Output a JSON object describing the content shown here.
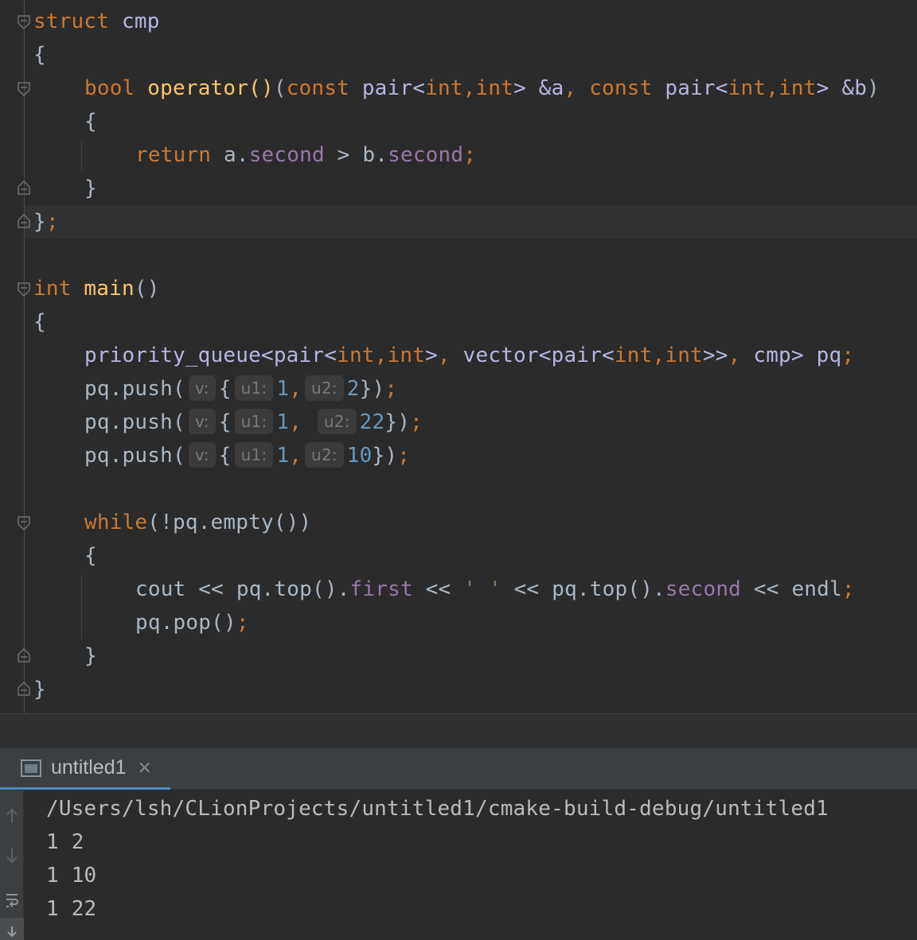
{
  "editor": {
    "lines": {
      "l1": {
        "kw": "struct",
        "name": "cmp"
      },
      "l2": {
        "brace": "{"
      },
      "l3": {
        "type": "bool",
        "fn": "operator",
        "parens": "()",
        "open": "(",
        "const1": "const",
        "pair1": "pair",
        "lt1": "<",
        "int1": "int",
        "comma1": ",",
        "int2": "int",
        "gt1": ">",
        "ref1": " &a",
        "sep": ",",
        "const2": "const",
        "pair2": "pair",
        "lt2": "<",
        "int3": "int",
        "comma2": ",",
        "int4": "int",
        "gt2": ">",
        "ref2": " &b",
        "close": ")"
      },
      "l4": {
        "brace": "{"
      },
      "l5": {
        "ret": "return",
        "a": "a.",
        "f1": "second",
        "op": " > ",
        "b": "b.",
        "f2": "second",
        "semi": ";"
      },
      "l6": {
        "brace": "}"
      },
      "l7": {
        "brace": "}",
        "semi": ";"
      },
      "l9": {
        "type": "int",
        "fn": "main",
        "parens": "()"
      },
      "l10": {
        "brace": "{"
      },
      "l11": {
        "pq": "priority_queue",
        "lt": "<",
        "pair": "pair",
        "lt2": "<",
        "int1": "int",
        "c1": ",",
        "int2": "int",
        "gt": ">",
        "c2": ",",
        "vec": "vector",
        "lt3": "<",
        "pair2": "pair",
        "lt4": "<",
        "int3": "int",
        "c3": ",",
        "int4": "int",
        "gt2": ">>",
        "c4": ",",
        "cmp": "cmp",
        "gt3": ">",
        "var": " pq",
        "semi": ";"
      },
      "push1": {
        "call": "pq.push(",
        "hint_v": "v:",
        "open": "{",
        "hint_u1": "u1:",
        "val1": "1",
        "comma": ",",
        "hint_u2": "u2:",
        "val2": "2",
        "close": "})",
        "semi": ";"
      },
      "push2": {
        "call": "pq.push(",
        "hint_v": "v:",
        "open": "{",
        "hint_u1": "u1:",
        "val1": "1",
        "comma": ",",
        "hint_u2": "u2:",
        "val2": "22",
        "close": "})",
        "semi": ";"
      },
      "push3": {
        "call": "pq.push(",
        "hint_v": "v:",
        "open": "{",
        "hint_u1": "u1:",
        "val1": "1",
        "comma": ",",
        "hint_u2": "u2:",
        "val2": "10",
        "close": "})",
        "semi": ";"
      },
      "l16": {
        "kw": "while",
        "rest": "(!pq.empty())"
      },
      "l17": {
        "brace": "{"
      },
      "l18": {
        "cout": "cout",
        "op1": " << ",
        "top1": "pq.top().",
        "first": "first",
        "op2": " << ",
        "space": "' '",
        "op3": " << ",
        "top2": "pq.top().",
        "second": "second",
        "op4": " << ",
        "endl": "endl",
        "semi": ";"
      },
      "l19": {
        "call": "pq.pop()",
        "semi": ";"
      },
      "l20": {
        "brace": "}"
      },
      "l21": {
        "brace": "}"
      }
    }
  },
  "run_panel": {
    "tab_label": "untitled1",
    "close_symbol": "×",
    "console_lines": [
      "/Users/lsh/CLionProjects/untitled1/cmake-build-debug/untitled1",
      "1 2",
      "1 10",
      "1 22"
    ]
  },
  "colors": {
    "background": "#2b2b2b",
    "keyword": "#cc7832",
    "function": "#ffc66d",
    "type": "#b5b6e3",
    "field": "#9876aa",
    "number": "#6897bb",
    "string": "#6a8759",
    "text": "#a9b7c6"
  },
  "icons": [
    "fold-open-icon",
    "fold-close-icon",
    "console-tab-icon",
    "close-icon",
    "arrow-up-icon",
    "arrow-down-icon",
    "soft-wrap-icon",
    "scroll-to-end-icon"
  ]
}
